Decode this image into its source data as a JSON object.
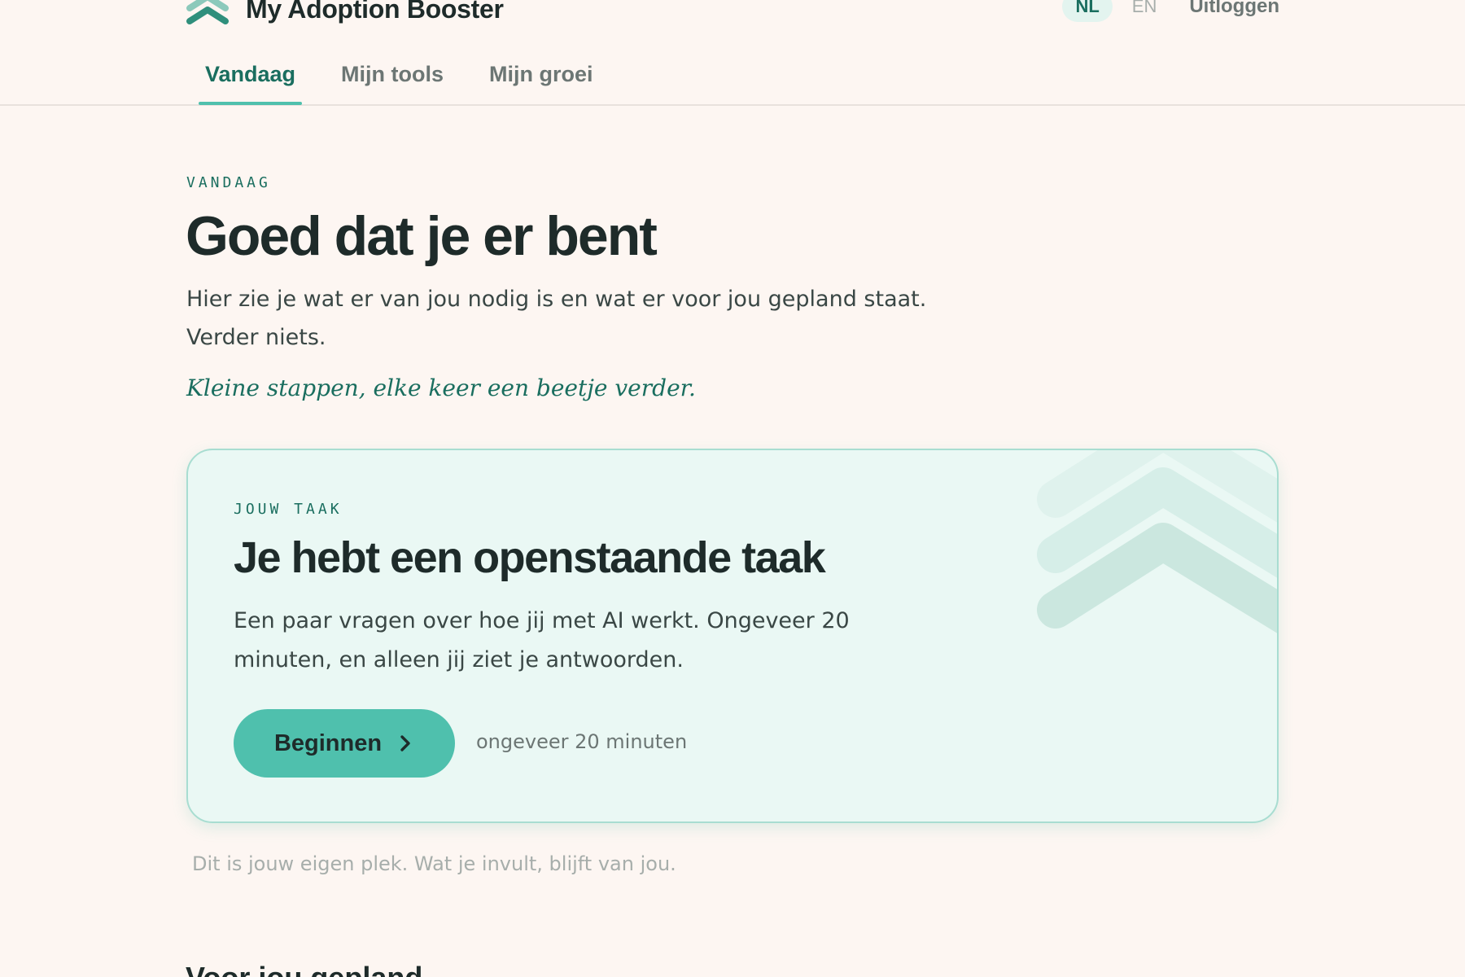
{
  "app": {
    "name": "My Adoption Booster",
    "logo_icon": "double-chevron-up-icon"
  },
  "header": {
    "languages": [
      {
        "label": "NL",
        "active": true
      },
      {
        "label": "EN",
        "active": false
      }
    ],
    "logout_label": "Uitloggen"
  },
  "tabs": [
    {
      "label": "Vandaag",
      "active": true
    },
    {
      "label": "Mijn tools",
      "active": false
    },
    {
      "label": "Mijn groei",
      "active": false
    }
  ],
  "intro": {
    "eyebrow": "VANDAAG",
    "title": "Goed dat je er bent",
    "text": "Hier zie je wat er van jou nodig is en wat er voor jou gepland staat. Verder niets.",
    "quote": "Kleine stappen, elke keer een beetje verder."
  },
  "task_card": {
    "eyebrow": "JOUW TAAK",
    "title": "Je hebt een openstaande taak",
    "description": "Een paar vragen over hoe jij met AI werkt. Ongeveer 20 minuten, en alleen jij ziet je antwoorden.",
    "button_label": "Beginnen",
    "button_icon": "chevron-right-icon",
    "duration": "ongeveer 20 minuten",
    "decoration_icon": "triple-chevron-up-icon"
  },
  "footnote": "Dit is jouw eigen plek. Wat je invult, blijft van jou.",
  "next_section": {
    "title": "Voor jou gepland"
  },
  "colors": {
    "background": "#fdf6f2",
    "accent": "#4fc0ad",
    "accent_dark": "#1a6e5f",
    "card_bg": "#eaf8f4",
    "text": "#1e2b2a",
    "muted": "#6c7674"
  }
}
